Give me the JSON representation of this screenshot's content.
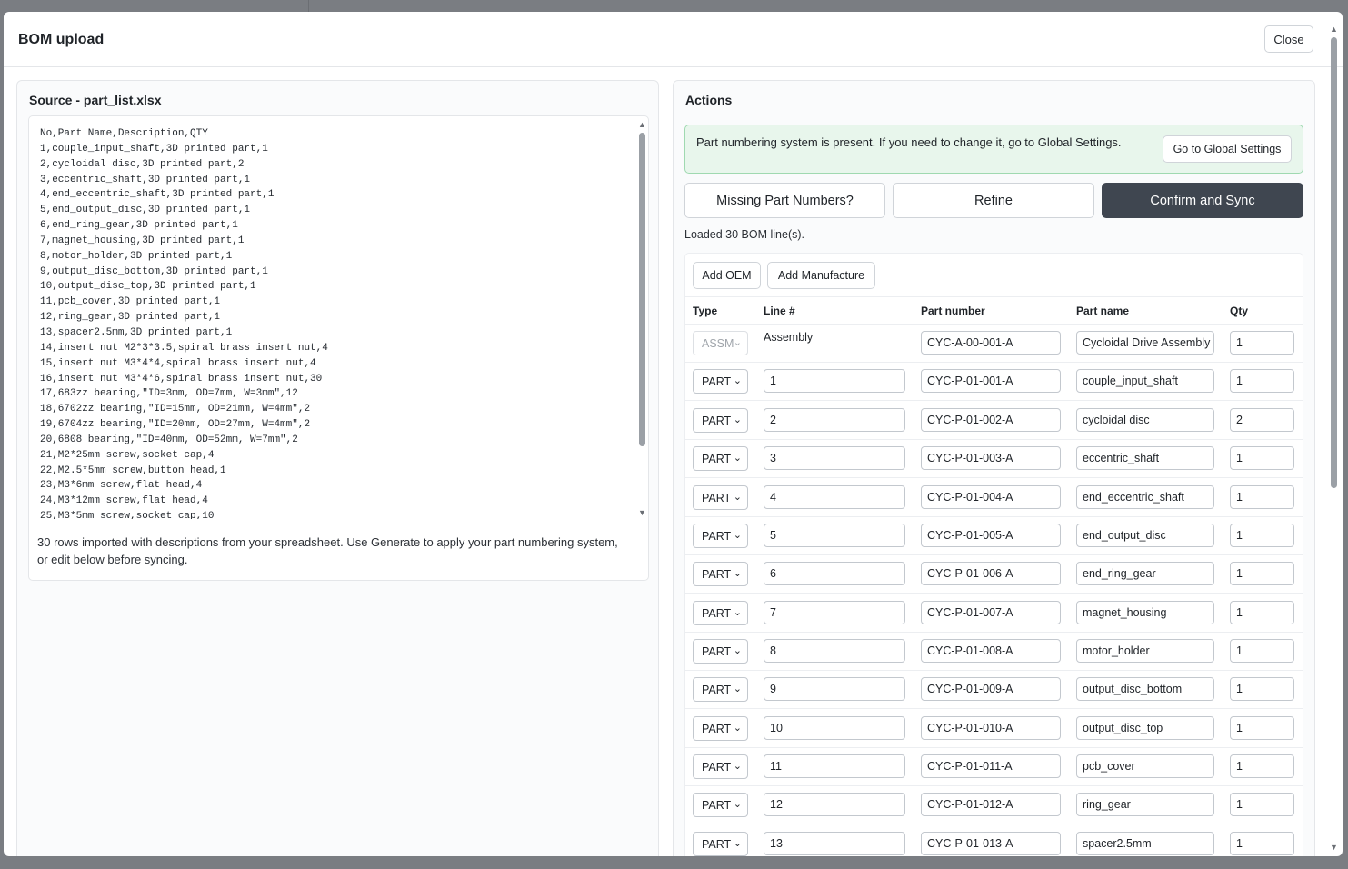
{
  "modal": {
    "title": "BOM upload",
    "close_label": "Close"
  },
  "source": {
    "title": "Source - part_list.xlsx",
    "text": "No,Part Name,Description,QTY\n1,couple_input_shaft,3D printed part,1\n2,cycloidal disc,3D printed part,2\n3,eccentric_shaft,3D printed part,1\n4,end_eccentric_shaft,3D printed part,1\n5,end_output_disc,3D printed part,1\n6,end_ring_gear,3D printed part,1\n7,magnet_housing,3D printed part,1\n8,motor_holder,3D printed part,1\n9,output_disc_bottom,3D printed part,1\n10,output_disc_top,3D printed part,1\n11,pcb_cover,3D printed part,1\n12,ring_gear,3D printed part,1\n13,spacer2.5mm,3D printed part,1\n14,insert nut M2*3*3.5,spiral brass insert nut,4\n15,insert nut M3*4*4,spiral brass insert nut,4\n16,insert nut M3*4*6,spiral brass insert nut,30\n17,683zz bearing,\"ID=3mm, OD=7mm, W=3mm\",12\n18,6702zz bearing,\"ID=15mm, OD=21mm, W=4mm\",2\n19,6704zz bearing,\"ID=20mm, OD=27mm, W=4mm\",2\n20,6808 bearing,\"ID=40mm, OD=52mm, W=7mm\",2\n21,M2*25mm screw,socket cap,4\n22,M2.5*5mm screw,button head,1\n23,M3*6mm screw,flat head,4\n24,M3*12mm screw,flat head,4\n25,M3*5mm screw,socket cap,10",
    "note": "30 rows imported with descriptions from your spreadsheet. Use Generate to apply your part numbering system, or edit below before syncing."
  },
  "actions": {
    "title": "Actions",
    "info_text": "Part numbering system is present. If you need to change it, go to Global Settings.",
    "global_settings_label": "Go to Global Settings",
    "missing_label": "Missing Part Numbers?",
    "refine_label": "Refine",
    "confirm_label": "Confirm and Sync",
    "loaded_text": "Loaded 30 BOM line(s).",
    "add_oem_label": "Add OEM",
    "add_manufacture_label": "Add Manufacture",
    "colors": {
      "confirm_bg": "#3f4650",
      "info_bg": "#e8f6ec",
      "info_border": "#9fd9b0"
    }
  },
  "table": {
    "headers": {
      "type": "Type",
      "line": "Line #",
      "part_number": "Part number",
      "part_name": "Part name",
      "qty": "Qty"
    },
    "rows": [
      {
        "type": "ASSM",
        "line": "Assembly",
        "part_number": "CYC-A-00-001-A",
        "part_name": "Cycloidal Drive Assembly",
        "qty": "1"
      },
      {
        "type": "PART",
        "line": "1",
        "part_number": "CYC-P-01-001-A",
        "part_name": "couple_input_shaft",
        "qty": "1"
      },
      {
        "type": "PART",
        "line": "2",
        "part_number": "CYC-P-01-002-A",
        "part_name": "cycloidal disc",
        "qty": "2"
      },
      {
        "type": "PART",
        "line": "3",
        "part_number": "CYC-P-01-003-A",
        "part_name": "eccentric_shaft",
        "qty": "1"
      },
      {
        "type": "PART",
        "line": "4",
        "part_number": "CYC-P-01-004-A",
        "part_name": "end_eccentric_shaft",
        "qty": "1"
      },
      {
        "type": "PART",
        "line": "5",
        "part_number": "CYC-P-01-005-A",
        "part_name": "end_output_disc",
        "qty": "1"
      },
      {
        "type": "PART",
        "line": "6",
        "part_number": "CYC-P-01-006-A",
        "part_name": "end_ring_gear",
        "qty": "1"
      },
      {
        "type": "PART",
        "line": "7",
        "part_number": "CYC-P-01-007-A",
        "part_name": "magnet_housing",
        "qty": "1"
      },
      {
        "type": "PART",
        "line": "8",
        "part_number": "CYC-P-01-008-A",
        "part_name": "motor_holder",
        "qty": "1"
      },
      {
        "type": "PART",
        "line": "9",
        "part_number": "CYC-P-01-009-A",
        "part_name": "output_disc_bottom",
        "qty": "1"
      },
      {
        "type": "PART",
        "line": "10",
        "part_number": "CYC-P-01-010-A",
        "part_name": "output_disc_top",
        "qty": "1"
      },
      {
        "type": "PART",
        "line": "11",
        "part_number": "CYC-P-01-011-A",
        "part_name": "pcb_cover",
        "qty": "1"
      },
      {
        "type": "PART",
        "line": "12",
        "part_number": "CYC-P-01-012-A",
        "part_name": "ring_gear",
        "qty": "1"
      },
      {
        "type": "PART",
        "line": "13",
        "part_number": "CYC-P-01-013-A",
        "part_name": "spacer2.5mm",
        "qty": "1"
      }
    ]
  }
}
